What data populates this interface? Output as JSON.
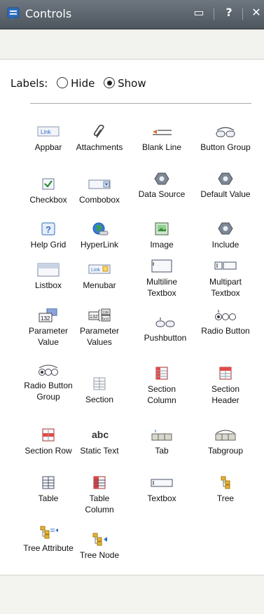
{
  "window": {
    "title": "Controls",
    "buttons": {
      "panel": "▭",
      "help": "?",
      "close": "✕"
    }
  },
  "labels_option": {
    "label": "Labels:",
    "options": [
      {
        "label": "Hide",
        "selected": false
      },
      {
        "label": "Show",
        "selected": true
      }
    ]
  },
  "controls": [
    {
      "label": "Appbar",
      "icon": "appbar-link-icon"
    },
    {
      "label": "Attachments",
      "icon": "paperclip-icon"
    },
    {
      "label": "Blank Line",
      "icon": "blank-line-icon"
    },
    {
      "label": "Button Group",
      "icon": "button-group-icon"
    },
    {
      "label": "Checkbox",
      "icon": "checkbox-icon"
    },
    {
      "label": "Combobox",
      "icon": "combobox-icon"
    },
    {
      "label": "Data Source",
      "icon": "data-source-icon"
    },
    {
      "label": "Default Value",
      "icon": "default-value-icon"
    },
    {
      "label": "Help Grid",
      "icon": "help-icon"
    },
    {
      "label": "HyperLink",
      "icon": "globe-link-icon"
    },
    {
      "label": "Image",
      "icon": "image-icon"
    },
    {
      "label": "Include",
      "icon": "include-icon"
    },
    {
      "label": "Listbox",
      "icon": "listbox-icon"
    },
    {
      "label": "Menubar",
      "icon": "menubar-icon"
    },
    {
      "label": "Multiline Textbox",
      "icon": "multiline-textbox-icon"
    },
    {
      "label": "Multipart Textbox",
      "icon": "multipart-textbox-icon"
    },
    {
      "label": "Parameter Value",
      "icon": "parameter-value-icon"
    },
    {
      "label": "Parameter Values",
      "icon": "parameter-values-icon"
    },
    {
      "label": "Pushbutton",
      "icon": "pushbutton-icon"
    },
    {
      "label": "Radio Button",
      "icon": "radio-button-icon"
    },
    {
      "label": "Radio Button Group",
      "icon": "radio-button-group-icon"
    },
    {
      "label": "Section",
      "icon": "section-icon"
    },
    {
      "label": "Section Column",
      "icon": "section-column-icon"
    },
    {
      "label": "Section Header",
      "icon": "section-header-icon"
    },
    {
      "label": "Section Row",
      "icon": "section-row-icon"
    },
    {
      "label": "Static Text",
      "icon": "static-text-icon"
    },
    {
      "label": "Tab",
      "icon": "tab-icon"
    },
    {
      "label": "Tabgroup",
      "icon": "tabgroup-icon"
    },
    {
      "label": "Table",
      "icon": "table-icon"
    },
    {
      "label": "Table Column",
      "icon": "table-column-icon"
    },
    {
      "label": "Textbox",
      "icon": "textbox-icon"
    },
    {
      "label": "Tree",
      "icon": "tree-icon"
    },
    {
      "label": "Tree Attribute",
      "icon": "tree-attribute-icon"
    },
    {
      "label": "Tree Node",
      "icon": "tree-node-icon"
    }
  ],
  "icon_text": {
    "appbar": "Link",
    "menubar": "Link",
    "parameter_value": "132",
    "parameter_values_main": "132",
    "parameter_values_a": "238",
    "parameter_values_b": "bcd",
    "static_text": "abc"
  },
  "colors": {
    "titlebar": "#5d656d",
    "accent_red": "#d43b3b",
    "accent_blue": "#2f6fbd"
  }
}
